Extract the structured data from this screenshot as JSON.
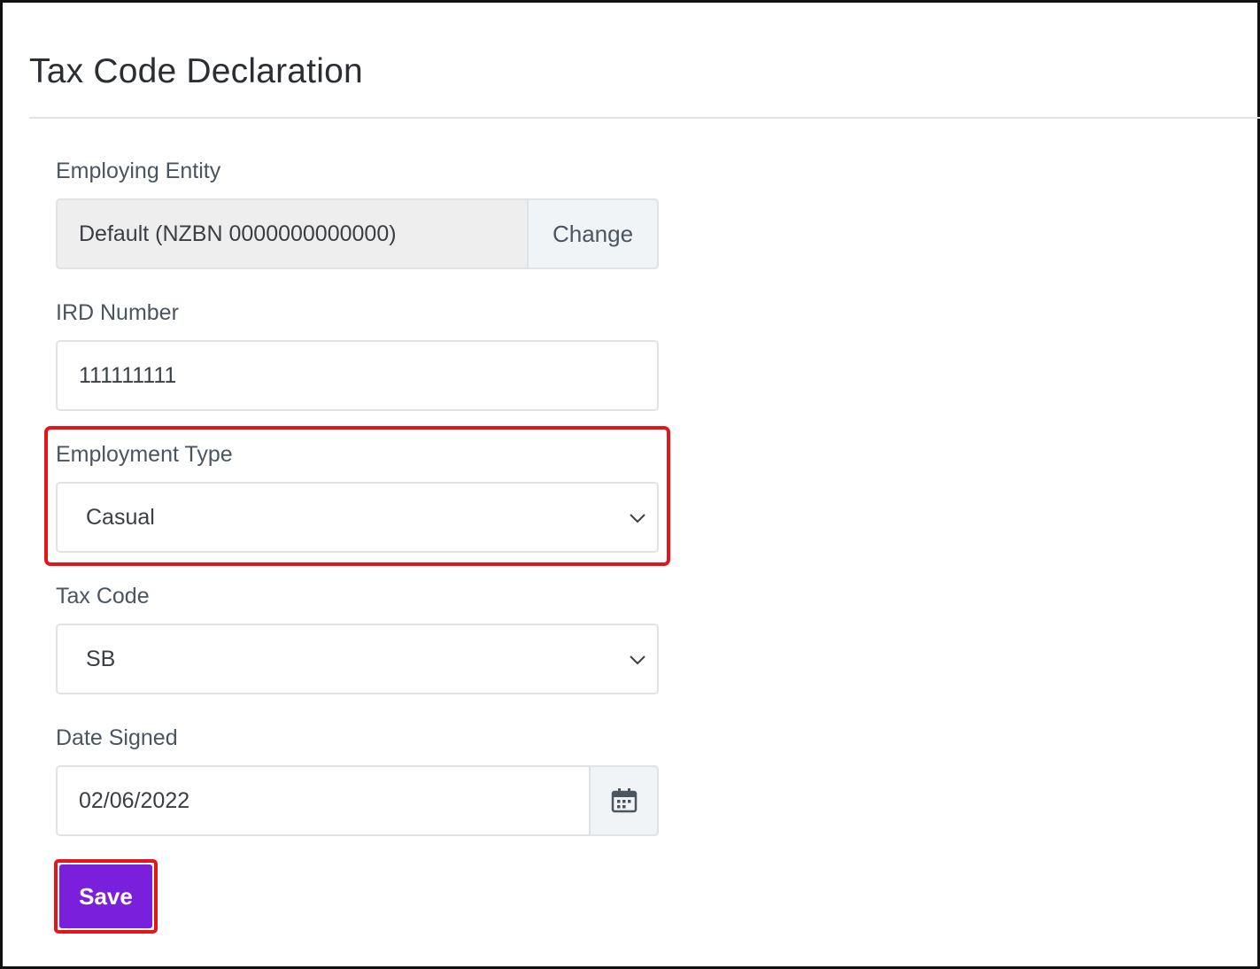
{
  "page": {
    "title": "Tax Code Declaration"
  },
  "form": {
    "employing_entity": {
      "label": "Employing Entity",
      "value": "Default (NZBN 0000000000000)",
      "change_label": "Change"
    },
    "ird_number": {
      "label": "IRD Number",
      "value": "111111111"
    },
    "employment_type": {
      "label": "Employment Type",
      "selected": "Casual"
    },
    "tax_code": {
      "label": "Tax Code",
      "selected": "SB"
    },
    "date_signed": {
      "label": "Date Signed",
      "value": "02/06/2022",
      "icon": "calendar-icon"
    },
    "save_label": "Save"
  },
  "colors": {
    "accent": "#7a1fdc",
    "highlight": "#e5161b"
  }
}
